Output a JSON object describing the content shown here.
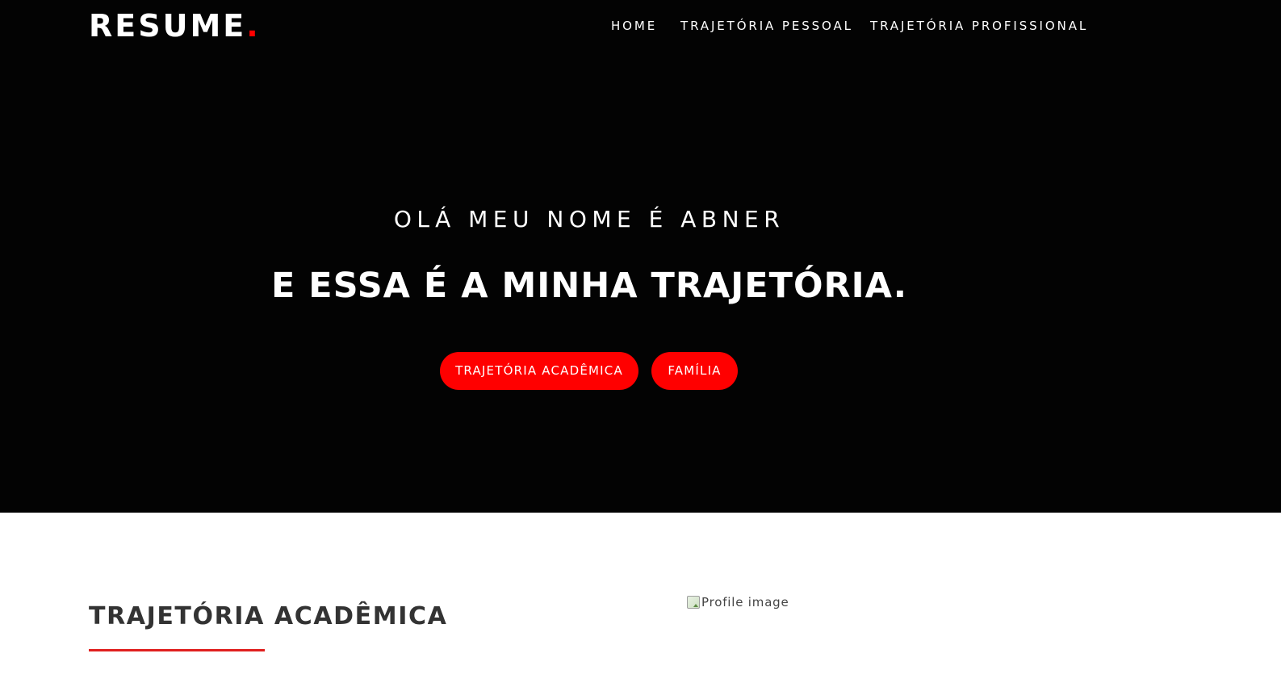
{
  "header": {
    "logo_text": "RESUME",
    "logo_dot": ".",
    "nav": [
      {
        "label": "HOME"
      },
      {
        "label": "TRAJETÓRIA PESSOAL"
      },
      {
        "label": "TRAJETÓRIA PROFISSIONAL"
      }
    ]
  },
  "hero": {
    "greeting": "OLÁ MEU NOME É ABNER",
    "headline": "E ESSA É A MINHA TRAJETÓRIA.",
    "buttons": [
      {
        "label": "TRAJETÓRIA ACADÊMICA"
      },
      {
        "label": "FAMÍLIA"
      }
    ]
  },
  "section": {
    "title": "TRAJETÓRIA ACADÊMICA",
    "image_alt": "Profile image"
  },
  "colors": {
    "hero_background": "#030303",
    "accent": "#ff0000",
    "text_light": "#ffffff",
    "text_dark": "#333333"
  },
  "icons": {
    "broken_image": "broken-image-icon"
  }
}
